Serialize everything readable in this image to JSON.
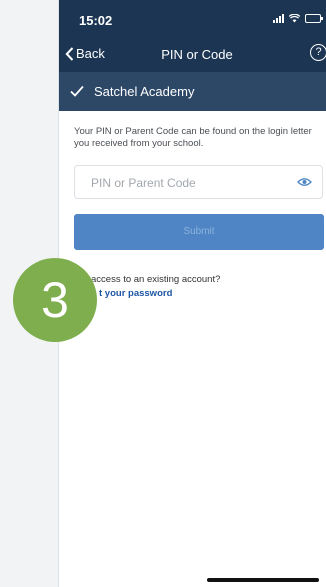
{
  "status_bar": {
    "time": "15:02"
  },
  "nav": {
    "back_label": "Back",
    "title": "PIN or Code",
    "help_symbol": "?"
  },
  "school": {
    "name": "Satchel Academy"
  },
  "main": {
    "info_text": "Your PIN or Parent Code can be found on the login letter you received from your school.",
    "pin_placeholder": "PIN or Parent Code",
    "submit_label": "Submit",
    "access_text": "access to an existing account?",
    "forgot_link": "t your password"
  },
  "step_badge": {
    "number": "3"
  },
  "colors": {
    "header": "#1b3553",
    "school_bar": "#2d4867",
    "submit": "#4f85c4",
    "link": "#1d56a5",
    "badge": "#7fae4e"
  }
}
